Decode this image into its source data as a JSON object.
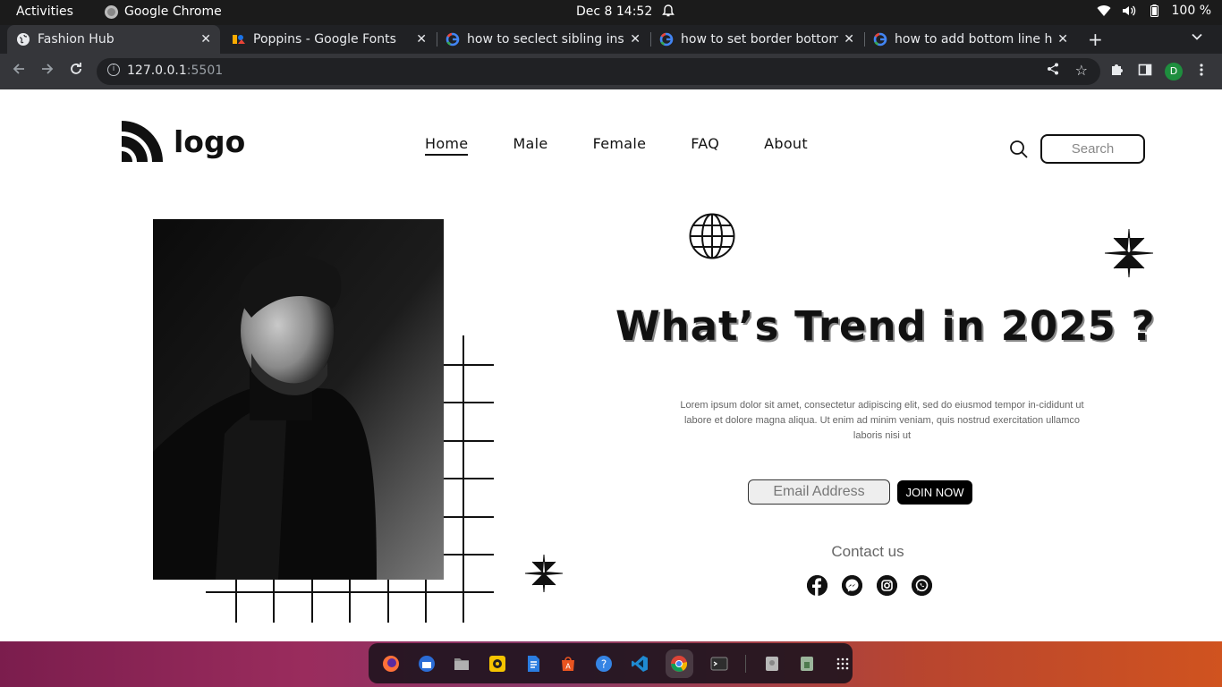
{
  "system_bar": {
    "activities": "Activities",
    "app_name": "Google Chrome",
    "clock": "Dec 8  14:52",
    "battery": "100 %"
  },
  "browser": {
    "tabs": [
      {
        "title": "Fashion Hub",
        "active": true
      },
      {
        "title": "Poppins - Google Fonts",
        "active": false
      },
      {
        "title": "how to seclect sibling insi",
        "active": false
      },
      {
        "title": "how to set border bottom",
        "active": false
      },
      {
        "title": "how to add bottom line h",
        "active": false
      }
    ],
    "url_host": "127.0.0.1",
    "url_port": ":5501",
    "profile_initial": "D"
  },
  "site": {
    "logo_text": "logo",
    "nav": [
      "Home",
      "Male",
      "Female",
      "FAQ",
      "About"
    ],
    "search_placeholder": "Search",
    "headline": "What’s Trend in 2025 ?",
    "body": "Lorem ipsum dolor sit amet, consectetur adipiscing elit, sed do eiusmod tempor in-cididunt ut labore et dolore magna aliqua. Ut enim ad minim veniam, quis nostrud exercitation ullamco laboris nisi ut",
    "email_placeholder": "Email Address",
    "join_label": "JOIN NOW",
    "contact_title": "Contact us",
    "socials": [
      "facebook-icon",
      "messenger-icon",
      "instagram-icon",
      "whatsapp-icon"
    ]
  },
  "dock": {
    "items": [
      "firefox-icon",
      "thunderbird-icon",
      "files-icon",
      "rhythmbox-icon",
      "writer-icon",
      "software-icon",
      "help-icon",
      "vscode-icon",
      "chrome-icon",
      "terminal-icon",
      "disk-icon",
      "trash-icon",
      "apps-grid-icon"
    ]
  }
}
